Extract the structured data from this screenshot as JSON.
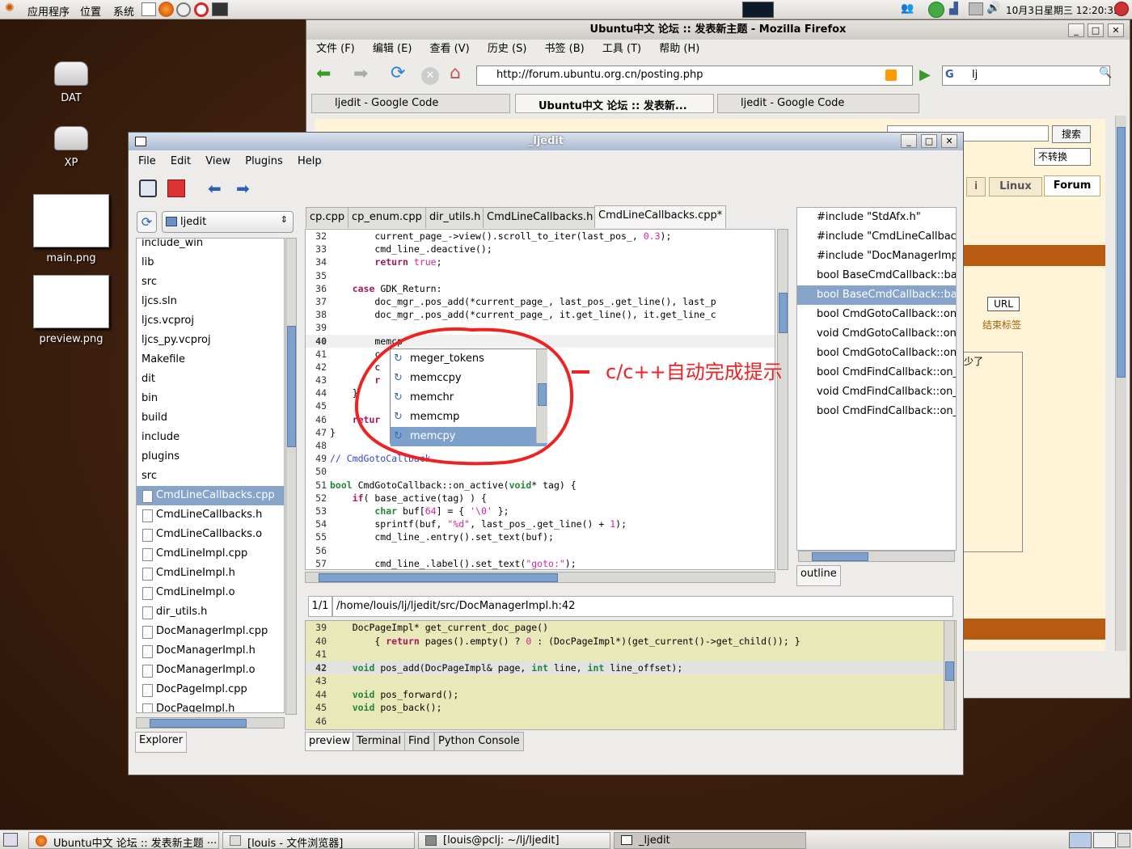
{
  "top_panel": {
    "menus": [
      "应用程序",
      "位置",
      "系统"
    ],
    "clock": "10月3日星期三 12:20:35"
  },
  "desktop_icons": [
    "DAT",
    "XP",
    "main.png",
    "preview.png"
  ],
  "firefox": {
    "title": "Ubuntu中文 论坛 :: 发表新主题 - Mozilla Firefox",
    "menus": [
      "文件 (F)",
      "编辑 (E)",
      "查看 (V)",
      "历史 (S)",
      "书签 (B)",
      "工具 (T)",
      "帮助 (H)"
    ],
    "url": "http://forum.ubuntu.org.cn/posting.php",
    "search_value": "lj",
    "tabs": [
      "ljedit - Google Code",
      "Ubuntu中文 论坛 :: 发表新...",
      "ljedit - Google Code"
    ],
    "page": {
      "search_button": "搜索",
      "select_value": "不转换",
      "nav_tabs": [
        "i",
        "Linux",
        "Forum"
      ],
      "url_button": "URL",
      "end_tag": "结束标签",
      "side_text": "少了"
    }
  },
  "jledit": {
    "title": "_ljedit",
    "menus": [
      "File",
      "Edit",
      "View",
      "Plugins",
      "Help"
    ],
    "explorer_combo": "ljedit",
    "tree": [
      {
        "label": "include_win",
        "type": "dir"
      },
      {
        "label": "lib",
        "type": "dir"
      },
      {
        "label": "src",
        "type": "dir"
      },
      {
        "label": "ljcs.sln",
        "type": "dir"
      },
      {
        "label": "ljcs.vcproj",
        "type": "dir"
      },
      {
        "label": "ljcs_py.vcproj",
        "type": "dir"
      },
      {
        "label": "Makefile",
        "type": "dir"
      },
      {
        "label": "dit",
        "type": "dir"
      },
      {
        "label": "bin",
        "type": "dir"
      },
      {
        "label": "build",
        "type": "dir"
      },
      {
        "label": "include",
        "type": "dir"
      },
      {
        "label": "plugins",
        "type": "dir"
      },
      {
        "label": "src",
        "type": "dir"
      },
      {
        "label": "CmdLineCallbacks.cpp",
        "type": "file",
        "selected": true
      },
      {
        "label": "CmdLineCallbacks.h",
        "type": "file"
      },
      {
        "label": "CmdLineCallbacks.o",
        "type": "file"
      },
      {
        "label": "CmdLineImpl.cpp",
        "type": "file"
      },
      {
        "label": "CmdLineImpl.h",
        "type": "file"
      },
      {
        "label": "CmdLineImpl.o",
        "type": "file"
      },
      {
        "label": "dir_utils.h",
        "type": "file"
      },
      {
        "label": "DocManagerImpl.cpp",
        "type": "file"
      },
      {
        "label": "DocManagerImpl.h",
        "type": "file"
      },
      {
        "label": "DocManagerImpl.o",
        "type": "file"
      },
      {
        "label": "DocPageImpl.cpp",
        "type": "file"
      },
      {
        "label": "DocPageImpl.h",
        "type": "file"
      }
    ],
    "explorer_tab": "Explorer",
    "editor_tabs": [
      "cp.cpp",
      "cp_enum.cpp",
      "dir_utils.h",
      "CmdLineCallbacks.h",
      "CmdLineCallbacks.cpp*"
    ],
    "autocomplete": [
      "meger_tokens",
      "memccpy",
      "memchr",
      "memcmp",
      "memcpy"
    ],
    "annotation": "c/c++自动完成提示",
    "outline": [
      "#include \"StdAfx.h\"",
      "#include \"CmdLineCallback",
      "#include \"DocManagerImpl",
      "bool BaseCmdCallback::bas",
      "bool BaseCmdCallback::bas",
      "bool CmdGotoCallback::on_",
      "void CmdGotoCallback::on_",
      "bool CmdGotoCallback::on_",
      "bool CmdFindCallback::on_a",
      "void CmdFindCallback::on_k",
      "bool CmdFindCallback::on_k"
    ],
    "outline_tab": "outline",
    "preview_counter": "1/1",
    "preview_path": "/home/louis/lj/ljedit/src/DocManagerImpl.h:42",
    "bottom_tabs": [
      "preview",
      "Terminal",
      "Find",
      "Python Console"
    ]
  },
  "taskbar": [
    "Ubuntu中文 论坛 :: 发表新主题 ···",
    "[louis - 文件浏览器]",
    "[louis@pclj: ~/lj/ljedit]",
    "_ljedit"
  ],
  "colors": {
    "selection": "#86a4ca",
    "preview_bg": "#e8e8b8",
    "annotation": "#ee2222"
  }
}
